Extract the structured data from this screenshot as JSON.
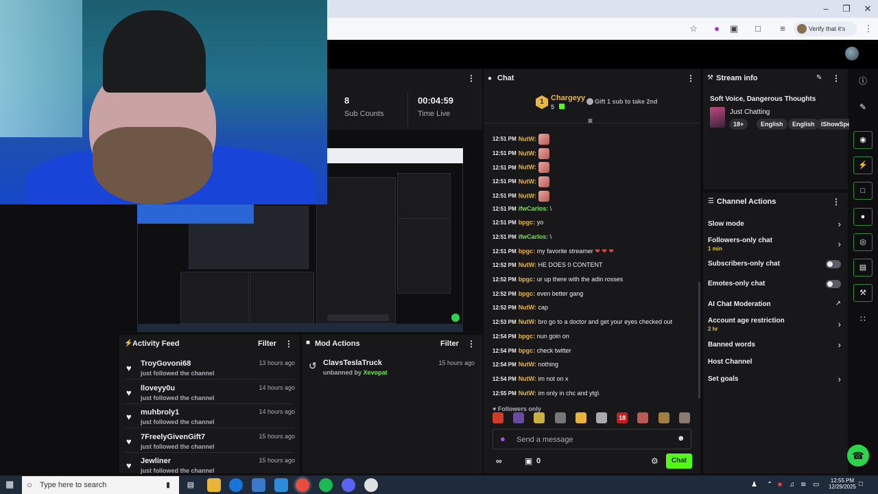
{
  "browser": {
    "verify_label": "Verify that it's you",
    "icons": [
      "minimize-icon",
      "restore-icon",
      "close-icon",
      "star-icon",
      "shield-icon",
      "puzzle-icon",
      "screenshot-icon",
      "reading-list-icon",
      "more-icon"
    ]
  },
  "stats": {
    "sub_counts": {
      "value": "8",
      "label": "Sub Counts"
    },
    "time_live": {
      "value": "00:04:59",
      "label": "Time Live"
    }
  },
  "activity_feed": {
    "title": "Activity Feed",
    "filter_label": "Filter",
    "items": [
      {
        "name": "TroyGovoni68",
        "sub": "just followed the channel",
        "time": "13 hours ago"
      },
      {
        "name": "lloveyy0u",
        "sub": "just followed the channel",
        "time": "14 hours ago"
      },
      {
        "name": "muhbroly1",
        "sub": "just followed the channel",
        "time": "14 hours ago"
      },
      {
        "name": "7FreelyGivenGift7",
        "sub": "just followed the channel",
        "time": "15 hours ago"
      },
      {
        "name": "Jewliner",
        "sub": "just followed the channel",
        "time": "15 hours ago"
      }
    ]
  },
  "mod_actions": {
    "title": "Mod Actions",
    "filter_label": "Filter",
    "items": [
      {
        "name": "ClavsTeslaTruck",
        "action": "unbanned by",
        "moderator": "Xevopat",
        "time": "15 hours ago"
      }
    ]
  },
  "chat": {
    "title": "Chat",
    "pinned_user": "Chargeyy",
    "pinned_rank": "1",
    "pinned_count": "5",
    "gift_label": "Gift 1 sub to take 2nd",
    "messages": [
      {
        "time": "12:51 PM",
        "user": "NutW",
        "text": "",
        "emote": true,
        "color": "nut"
      },
      {
        "time": "12:51 PM",
        "user": "NutW",
        "text": "",
        "emote": true,
        "color": "nut"
      },
      {
        "time": "12:51 PM",
        "user": "NutW",
        "text": "",
        "emote": true,
        "color": "nut"
      },
      {
        "time": "12:51 PM",
        "user": "NutW",
        "text": "",
        "emote": true,
        "color": "nut"
      },
      {
        "time": "12:51 PM",
        "user": "NutW",
        "text": "",
        "emote": true,
        "color": "nut"
      },
      {
        "time": "12:51 PM",
        "user": "ifwCarlos",
        "text": "\\",
        "emote": false,
        "color": "ifw"
      },
      {
        "time": "12:51 PM",
        "user": "bpgc",
        "text": "yo",
        "emote": false,
        "color": "bp"
      },
      {
        "time": "12:51 PM",
        "user": "ifwCarlos",
        "text": "\\",
        "emote": false,
        "color": "ifw"
      },
      {
        "time": "12:51 PM",
        "user": "bpgc",
        "text": "my favorite streamer",
        "emote": false,
        "color": "bp",
        "hearts": "❤ ❤ ❤"
      },
      {
        "time": "12:52 PM",
        "user": "NutW",
        "text": "HE DOES 0 CONTENT",
        "emote": false,
        "color": "nut"
      },
      {
        "time": "12:52 PM",
        "user": "bpgc",
        "text": "ur up there with the adin rosses",
        "emote": false,
        "color": "bp"
      },
      {
        "time": "12:52 PM",
        "user": "bpgc",
        "text": "even better gang",
        "emote": false,
        "color": "bp"
      },
      {
        "time": "12:52 PM",
        "user": "NutW",
        "text": "cap",
        "emote": false,
        "color": "nut"
      },
      {
        "time": "12:53 PM",
        "user": "NutW",
        "text": "bro go to a doctor and get your eyes checked out",
        "emote": false,
        "color": "nut"
      },
      {
        "time": "12:54 PM",
        "user": "bpgc",
        "text": "nun goin on",
        "emote": false,
        "color": "bp"
      },
      {
        "time": "12:54 PM",
        "user": "bpgc",
        "text": "check twitter",
        "emote": false,
        "color": "bp"
      },
      {
        "time": "12:54 PM",
        "user": "NutW",
        "text": "nothing",
        "emote": false,
        "color": "nut"
      },
      {
        "time": "12:54 PM",
        "user": "NutW",
        "text": "im not on x",
        "emote": false,
        "color": "nut"
      },
      {
        "time": "12:55 PM",
        "user": "NutW",
        "text": "im only in chc and ytg\\",
        "emote": false,
        "color": "nut"
      }
    ],
    "followers_only": "Followers only",
    "quick_emotes": [
      "18"
    ],
    "input_placeholder": "Send a message",
    "points": "0",
    "send_label": "Chat"
  },
  "stream_info": {
    "title": "Stream info",
    "stream_title": "Soft Voice, Dangerous Thoughts",
    "category": "Just Chatting",
    "tags": [
      "18+",
      "English",
      "English",
      "IShowSpe"
    ]
  },
  "channel_actions": {
    "title": "Channel Actions",
    "items": [
      {
        "label": "Slow mode",
        "kind": "chevron",
        "sub": ""
      },
      {
        "label": "Followers-only chat",
        "kind": "chevron",
        "sub": "1 min"
      },
      {
        "label": "Subscribers-only chat",
        "kind": "toggle",
        "sub": ""
      },
      {
        "label": "Emotes-only chat",
        "kind": "toggle",
        "sub": ""
      },
      {
        "label": "AI Chat Moderation",
        "kind": "external",
        "sub": ""
      },
      {
        "label": "Account age restriction",
        "kind": "chevron",
        "sub": "2 hr"
      },
      {
        "label": "Banned words",
        "kind": "chevron",
        "sub": ""
      },
      {
        "label": "Host Channel",
        "kind": "none",
        "sub": ""
      },
      {
        "label": "Set goals",
        "kind": "chevron",
        "sub": ""
      }
    ]
  },
  "taskbar": {
    "search_placeholder": "Type here to search",
    "time": "12:55 PM",
    "date": "12/29/2025"
  },
  "colors": {
    "accent": "#53fc18",
    "panel": "#18181b",
    "background": "#0e0e10",
    "username_gold": "#e8b53a",
    "username_green": "#7ae04a"
  }
}
